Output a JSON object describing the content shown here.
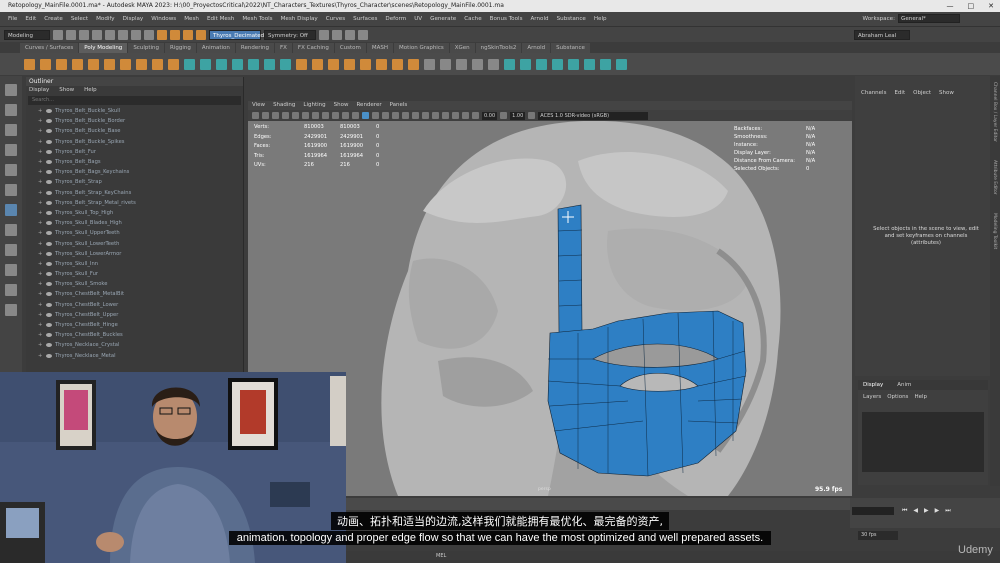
{
  "window": {
    "title": "Retopology_MainFile.0001.ma* - Autodesk MAYA 2023: H:\\00_ProyectosCritical\\2022\\NT_Characters_Textures\\Thyros_Character\\scenes\\Retopology_MainFile.0001.ma"
  },
  "menu": [
    "File",
    "Edit",
    "Create",
    "Select",
    "Modify",
    "Display",
    "Windows",
    "Mesh",
    "Edit Mesh",
    "Mesh Tools",
    "Mesh Display",
    "Curves",
    "Surfaces",
    "Deform",
    "UV",
    "Generate",
    "Cache",
    "Bonus Tools",
    "Arnold",
    "Substance",
    "Help"
  ],
  "workspace": {
    "label": "Workspace:",
    "value": "General*"
  },
  "status": {
    "mode": "Modeling",
    "object": "Thyros_Decimated",
    "symmetry": "Symmetry: Off",
    "user": "Abraham Leal"
  },
  "shelf_tabs": [
    "Curves / Surfaces",
    "Poly Modeling",
    "Sculpting",
    "Rigging",
    "Animation",
    "Rendering",
    "FX",
    "FX Caching",
    "Custom",
    "MASH",
    "Motion Graphics",
    "XGen",
    "ngSkinTools2",
    "Arnold",
    "Substance"
  ],
  "shelf_active": "Poly Modeling",
  "outliner": {
    "title": "Outliner",
    "menu": [
      "Display",
      "Show",
      "Help"
    ],
    "search_placeholder": "Search...",
    "items": [
      "Thyros_Belt_Buckle_Skull",
      "Thyros_Belt_Buckle_Border",
      "Thyros_Belt_Buckle_Base",
      "Thyros_Belt_Buckle_Spikes",
      "Thyros_Belt_Fur",
      "Thyros_Belt_Bags",
      "Thyros_Belt_Bags_Keychains",
      "Thyros_Belt_Strap",
      "Thyros_Belt_Strap_KeyChains",
      "Thyros_Belt_Strap_Metal_rivets",
      "Thyros_Skull_Top_High",
      "Thyros_Skull_Blades_High",
      "Thyros_Skull_UpperTeeth",
      "Thyros_Skull_LowerTeeth",
      "Thyros_Skull_LowerArmor",
      "Thyros_Skull_Inn",
      "Thyros_Skull_Fur",
      "Thyros_Skull_Smoke",
      "Thyros_ChestBelt_MetalBit",
      "Thyros_ChestBelt_Lower",
      "Thyros_ChestBelt_Upper",
      "Thyros_ChestBelt_Hinge",
      "Thyros_ChestBelt_Buckles",
      "Thyros_Necklace_Crystal",
      "Thyros_Necklace_Metal"
    ]
  },
  "viewport": {
    "menu": [
      "View",
      "Shading",
      "Lighting",
      "Show",
      "Renderer",
      "Panels"
    ],
    "exposure": "0.00",
    "gamma": "1.00",
    "colorspace": "ACES 1.0 SDR-video (sRGB)",
    "camera": "persp",
    "fps": "95.9 fps",
    "hud_left": [
      {
        "label": "Verts:",
        "a": "810003",
        "b": "810003",
        "c": "0"
      },
      {
        "label": "Edges:",
        "a": "2429901",
        "b": "2429901",
        "c": "0"
      },
      {
        "label": "Faces:",
        "a": "1619900",
        "b": "1619900",
        "c": "0"
      },
      {
        "label": "Tris:",
        "a": "1619964",
        "b": "1619964",
        "c": "0"
      },
      {
        "label": "UVs:",
        "a": "216",
        "b": "216",
        "c": "0"
      }
    ],
    "hud_right": [
      {
        "label": "Backfaces:",
        "v": "N/A"
      },
      {
        "label": "Smoothness:",
        "v": "N/A"
      },
      {
        "label": "Instance:",
        "v": "N/A"
      },
      {
        "label": "Display Layer:",
        "v": "N/A"
      },
      {
        "label": "Distance From Camera:",
        "v": "N/A"
      },
      {
        "label": "Selected Objects:",
        "v": "0"
      }
    ]
  },
  "channel_box": {
    "menu": [
      "Channels",
      "Edit",
      "Object",
      "Show"
    ],
    "message": "Select objects in the scene to view, edit and set keyframes on channels (attributes)"
  },
  "side_tabs": [
    "Channel Box / Layer Editor",
    "Attribute Editor",
    "Modeling Toolkit"
  ],
  "layers": {
    "tabs": [
      "Display",
      "Anim"
    ],
    "menu": [
      "Layers",
      "Options",
      "Help"
    ]
  },
  "playback": {
    "fps": "30 fps"
  },
  "mel_label": "MEL",
  "subtitles": {
    "cn": "动画、拓扑和适当的边流,这样我们就能拥有最优化、最完备的资产,",
    "en": "animation. topology and proper edge flow so that we can have the most optimized and well prepared assets."
  },
  "brand": "Udemy",
  "colors": {
    "topology": "#2e7fc4",
    "accent": "#4a90c8"
  }
}
